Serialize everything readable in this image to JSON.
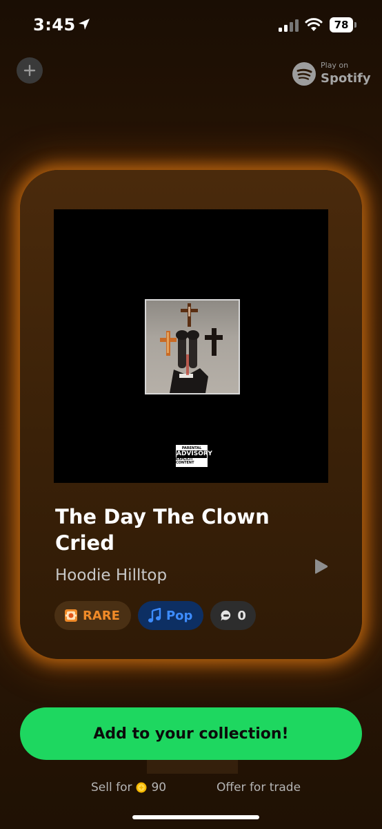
{
  "status_bar": {
    "time": "3:45",
    "battery": "78"
  },
  "header": {
    "spotify_small": "Play on",
    "spotify_big": "Spotify"
  },
  "track": {
    "title": "The Day The Clown Cried",
    "artist": "Hoodie Hilltop",
    "advisory_top": "PARENTAL",
    "advisory_mid": "ADVISORY",
    "advisory_bottom": "EXPLICIT CONTENT"
  },
  "tags": {
    "rarity": "RARE",
    "genre": "Pop",
    "count": "0"
  },
  "actions": {
    "add_label": "Add to your collection!",
    "sell_label": "Sell for",
    "sell_price": "90",
    "offer_label": "Offer for trade"
  },
  "colors": {
    "accent_green": "#1ed760",
    "glow_orange": "#ff8c14",
    "rare_orange": "#f08a28",
    "pop_blue": "#3d8cff"
  },
  "icons": [
    "location-arrow-icon",
    "signal-icon",
    "wifi-icon",
    "battery-icon",
    "plus-icon",
    "spotify-icon",
    "play-icon",
    "rare-badge-icon",
    "music-note-icon",
    "chat-icon",
    "coin-icon"
  ]
}
